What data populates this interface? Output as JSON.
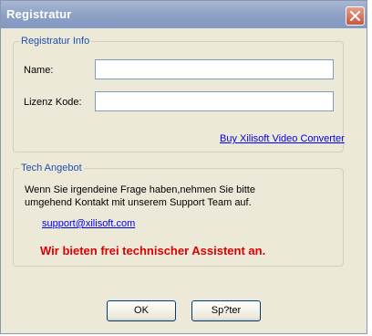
{
  "window": {
    "title": "Registratur"
  },
  "registration": {
    "legend": "Registratur Info",
    "name_label": "Name:",
    "name_value": "",
    "license_label": "Lizenz Kode:",
    "license_value": "",
    "buy_link": "Buy Xilisoft Video Converter"
  },
  "tech": {
    "legend": "Tech Angebot",
    "text_line1": "Wenn Sie irgendeine Frage haben,nehmen Sie bitte",
    "text_line2": "umgehend Kontakt mit unserem Support Team auf.",
    "email": "support@xilisoft.com",
    "highlight": "Wir bieten frei technischer Assistent an.",
    "highlight_color": "#dd0000"
  },
  "buttons": {
    "ok": "OK",
    "later": "Sp?ter"
  },
  "icons": {
    "close": "close-icon"
  }
}
